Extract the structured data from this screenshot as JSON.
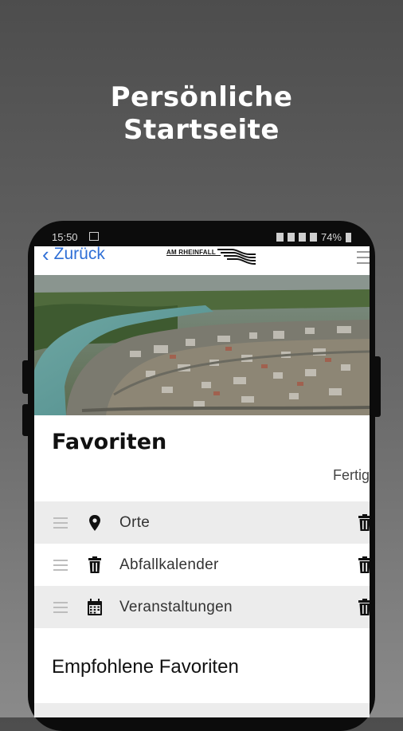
{
  "headline": {
    "line1": "Persönliche",
    "line2": "Startseite"
  },
  "status_bar": {
    "time": "15:50",
    "battery": "74%"
  },
  "app_bar": {
    "back_label": "Zurück",
    "logo_text": "AM RHEINFALL"
  },
  "favorites": {
    "title": "Favoriten",
    "done_label": "Fertig",
    "items": [
      {
        "label": "Orte",
        "icon": "location-pin-icon"
      },
      {
        "label": "Abfallkalender",
        "icon": "trash-icon"
      },
      {
        "label": "Veranstaltungen",
        "icon": "calendar-icon"
      }
    ]
  },
  "recommended": {
    "title": "Empfohlene Favoriten"
  },
  "colors": {
    "link": "#2f6fd6",
    "row_shade": "#ececec"
  }
}
